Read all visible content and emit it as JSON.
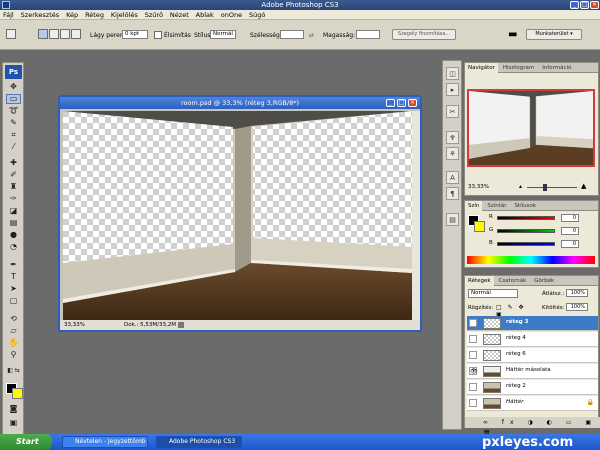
{
  "app": {
    "title": "Adobe Photoshop CS3",
    "logo_text": "Ps"
  },
  "menu": [
    "Fájl",
    "Szerkesztés",
    "Kép",
    "Réteg",
    "Kijelölés",
    "Szűrő",
    "Nézet",
    "Ablak",
    "onOne",
    "Súgó"
  ],
  "options": {
    "feather_label": "Lágy perem:",
    "feather_value": "0 kpt",
    "antialias_label": "Élsimítás",
    "style_label": "Stílus:",
    "style_value": "Normál",
    "width_label": "Szélesség:",
    "height_label": "Magasság:",
    "refine_edge_button": "Szegély finomítása...",
    "workspace_button": "Munkaterület ▾"
  },
  "document": {
    "title": "room.psd @ 33,3% (réteg 3,RGB/8*)",
    "zoom": "33,33%",
    "doc_size": "Dok.: 5,53M/33,2M"
  },
  "navigator": {
    "tabs": [
      "Navigátor",
      "Hisztogram",
      "Információ"
    ],
    "zoom": "33,33%"
  },
  "color_panel": {
    "tabs": [
      "Szín",
      "Színtár",
      "Stílusok"
    ],
    "channels": [
      {
        "label": "R",
        "value": "0"
      },
      {
        "label": "G",
        "value": "0"
      },
      {
        "label": "B",
        "value": "0"
      }
    ]
  },
  "layers_panel": {
    "tabs": [
      "Rétegek",
      "Csatornák",
      "Görbék"
    ],
    "blend_mode": "Normál",
    "opacity_label": "Átlátsz.:",
    "opacity_value": "100%",
    "lock_label": "Rögzítés:",
    "fill_label": "Kitöltés:",
    "fill_value": "100%",
    "layers": [
      {
        "name": "réteg 3",
        "selected": true,
        "visible": false,
        "thumb": "checker"
      },
      {
        "name": "réteg 4",
        "selected": false,
        "visible": false,
        "thumb": "checker"
      },
      {
        "name": "réteg 6",
        "selected": false,
        "visible": false,
        "thumb": "checker"
      },
      {
        "name": "Háttér másolata",
        "selected": false,
        "visible": true,
        "thumb": "room"
      },
      {
        "name": "réteg 2",
        "selected": false,
        "visible": false,
        "thumb": "room"
      },
      {
        "name": "Háttér",
        "selected": false,
        "visible": false,
        "thumb": "room",
        "locked": true,
        "italic": true
      }
    ]
  },
  "taskbar": {
    "start": "Start",
    "tasks": [
      "Névtelen - Jegyzettömb",
      "Adobe Photoshop CS3"
    ]
  },
  "watermark": "pxleyes.com",
  "colors": {
    "foreground": "#000000",
    "background": "#fff800",
    "layer_selected": "#3d7bc8"
  }
}
